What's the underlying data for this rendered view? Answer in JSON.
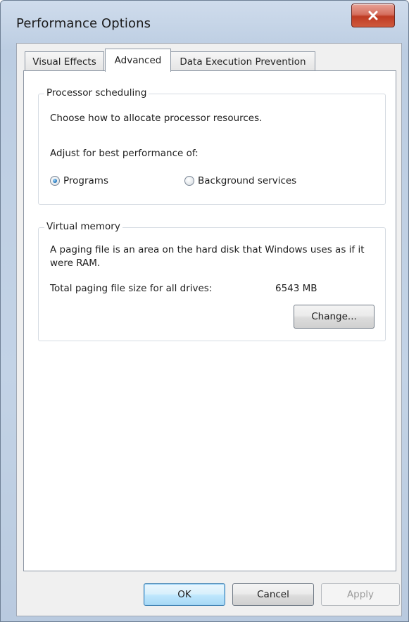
{
  "window": {
    "title": "Performance Options"
  },
  "tabs": [
    {
      "label": "Visual Effects",
      "active": false
    },
    {
      "label": "Advanced",
      "active": true
    },
    {
      "label": "Data Execution Prevention",
      "active": false
    }
  ],
  "processor_scheduling": {
    "legend": "Processor scheduling",
    "description": "Choose how to allocate processor resources.",
    "adjust_label": "Adjust for best performance of:",
    "options": [
      {
        "label": "Programs",
        "selected": true
      },
      {
        "label": "Background services",
        "selected": false
      }
    ]
  },
  "virtual_memory": {
    "legend": "Virtual memory",
    "description": "A paging file is an area on the hard disk that Windows uses as if it were RAM.",
    "total_label": "Total paging file size for all drives:",
    "total_value": "6543 MB",
    "change_button": "Change..."
  },
  "footer": {
    "ok": "OK",
    "cancel": "Cancel",
    "apply": "Apply"
  },
  "icons": {
    "close": "close-icon"
  },
  "colors": {
    "title_bar": "#c3d3e6",
    "close_button": "#c9452b",
    "default_button": "#bee6fd"
  }
}
